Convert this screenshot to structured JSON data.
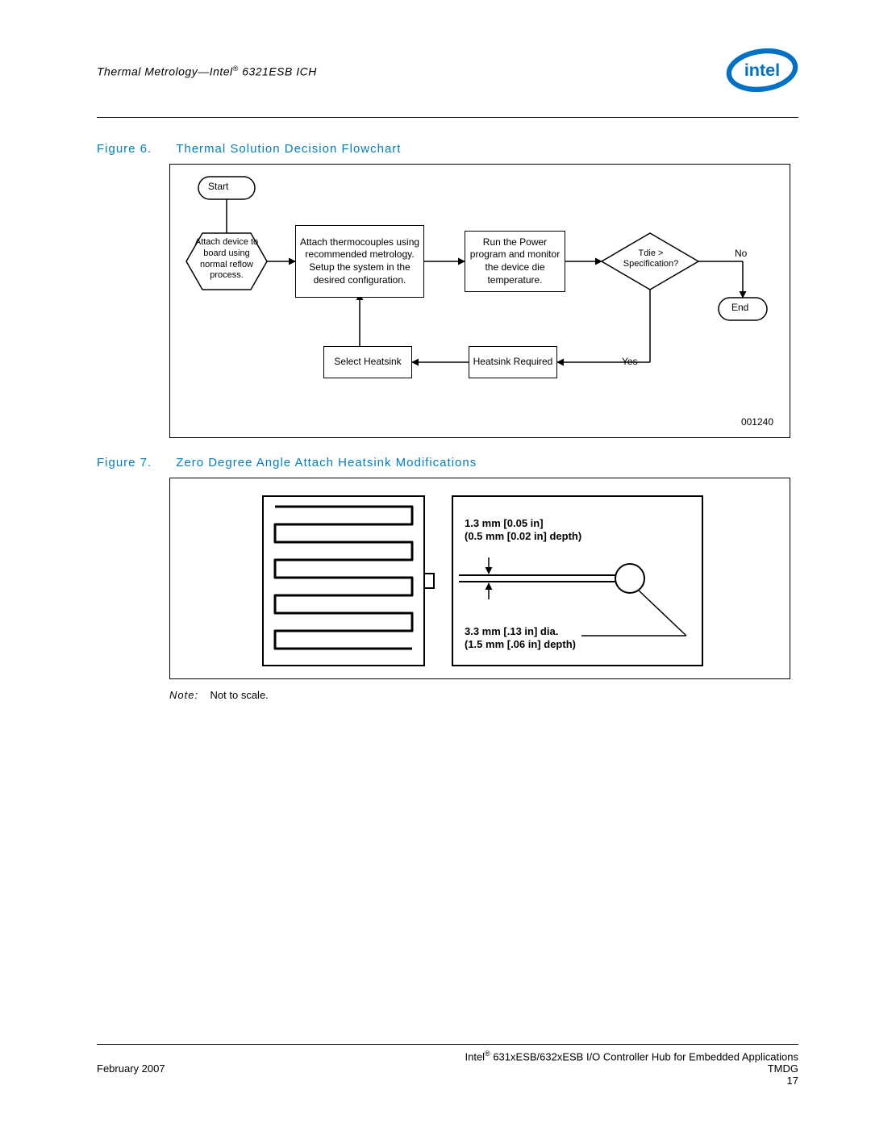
{
  "header": {
    "left_pre": "Thermal Metrology—Intel",
    "left_post": " 6321ESB ICH",
    "reg": "®"
  },
  "figure6": {
    "label": "Figure 6.",
    "title": "Thermal Solution Decision Flowchart",
    "ref": "001240",
    "nodes": {
      "start": "Start",
      "attach_device": "Attach device to board using normal reflow process.",
      "attach_thermo": "Attach thermocouples using recommended metrology. Setup the system in the desired configuration.",
      "run_power": "Run the Power program and monitor the device die temperature.",
      "decision": "Tdie > Specification?",
      "no": "No",
      "end": "End",
      "yes": "Yes",
      "heatsink_req": "Heatsink Required",
      "select_hs": "Select Heatsink"
    }
  },
  "figure7": {
    "label": "Figure 7.",
    "title": "Zero Degree Angle Attach Heatsink Modifications",
    "dims": {
      "groove1_w": "1.3 mm [0.05 in]",
      "groove1_d": "(0.5 mm [0.02 in] depth)",
      "hole_dia": "3.3 mm [.13 in] dia.",
      "hole_d": "(1.5 mm [.06 in] depth)"
    }
  },
  "note": {
    "label": "Note:",
    "text": "Not to scale."
  },
  "footer": {
    "right1_pre": "Intel",
    "right1_reg": "®",
    "right1_post": " 631xESB/632xESB I/O Controller Hub for Embedded Applications",
    "left": "February 2007",
    "right2": "TMDG",
    "right3": "17"
  }
}
